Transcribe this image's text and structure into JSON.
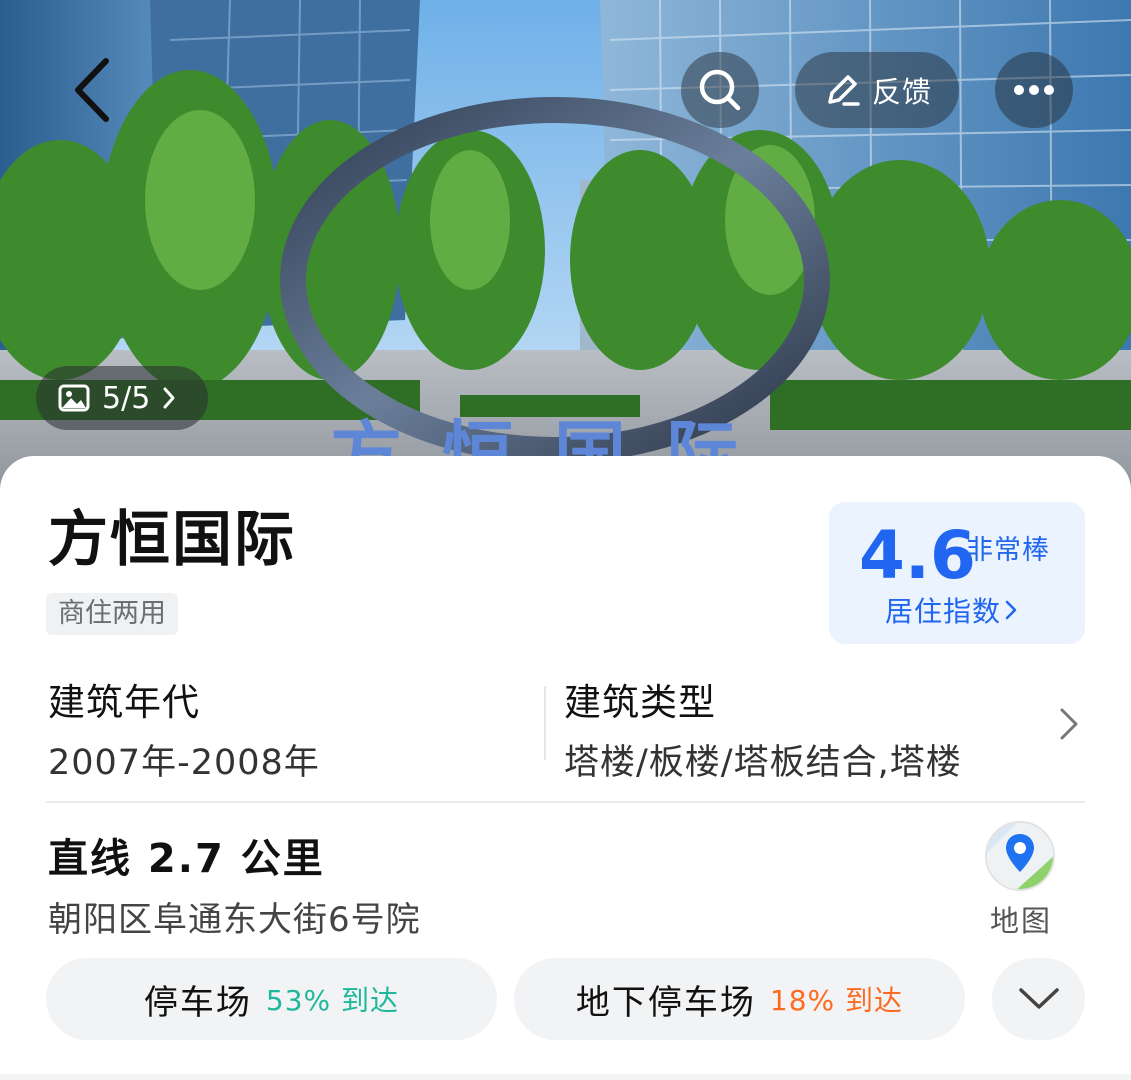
{
  "header": {
    "feedback_label": "反馈",
    "back_icon": "chevron-left-icon",
    "search_icon": "search-icon",
    "feedback_icon": "edit-icon",
    "more_icon": "more-icon"
  },
  "hero": {
    "photo_counter": "5/5",
    "sign_text": "方恒国际"
  },
  "place": {
    "name": "方恒国际",
    "tag": "商住两用",
    "rating": {
      "score": "4.6",
      "word": "非常棒",
      "link_label": "居住指数"
    }
  },
  "info": {
    "year_label": "建筑年代",
    "year_value": "2007年-2008年",
    "type_label": "建筑类型",
    "type_value": "塔楼/板楼/塔板结合,塔楼"
  },
  "location": {
    "distance": "直线 2.7 公里",
    "address": "朝阳区阜通东大街6号院",
    "map_label": "地图"
  },
  "parking": [
    {
      "name": "停车场",
      "arrival": "53% 到达",
      "color": "#1fb89a"
    },
    {
      "name": "地下停车场",
      "arrival": "18% 到达",
      "color": "#ff6a1f"
    }
  ],
  "colors": {
    "accent": "#2166f0",
    "rating_bg": "#eaf3fe"
  }
}
